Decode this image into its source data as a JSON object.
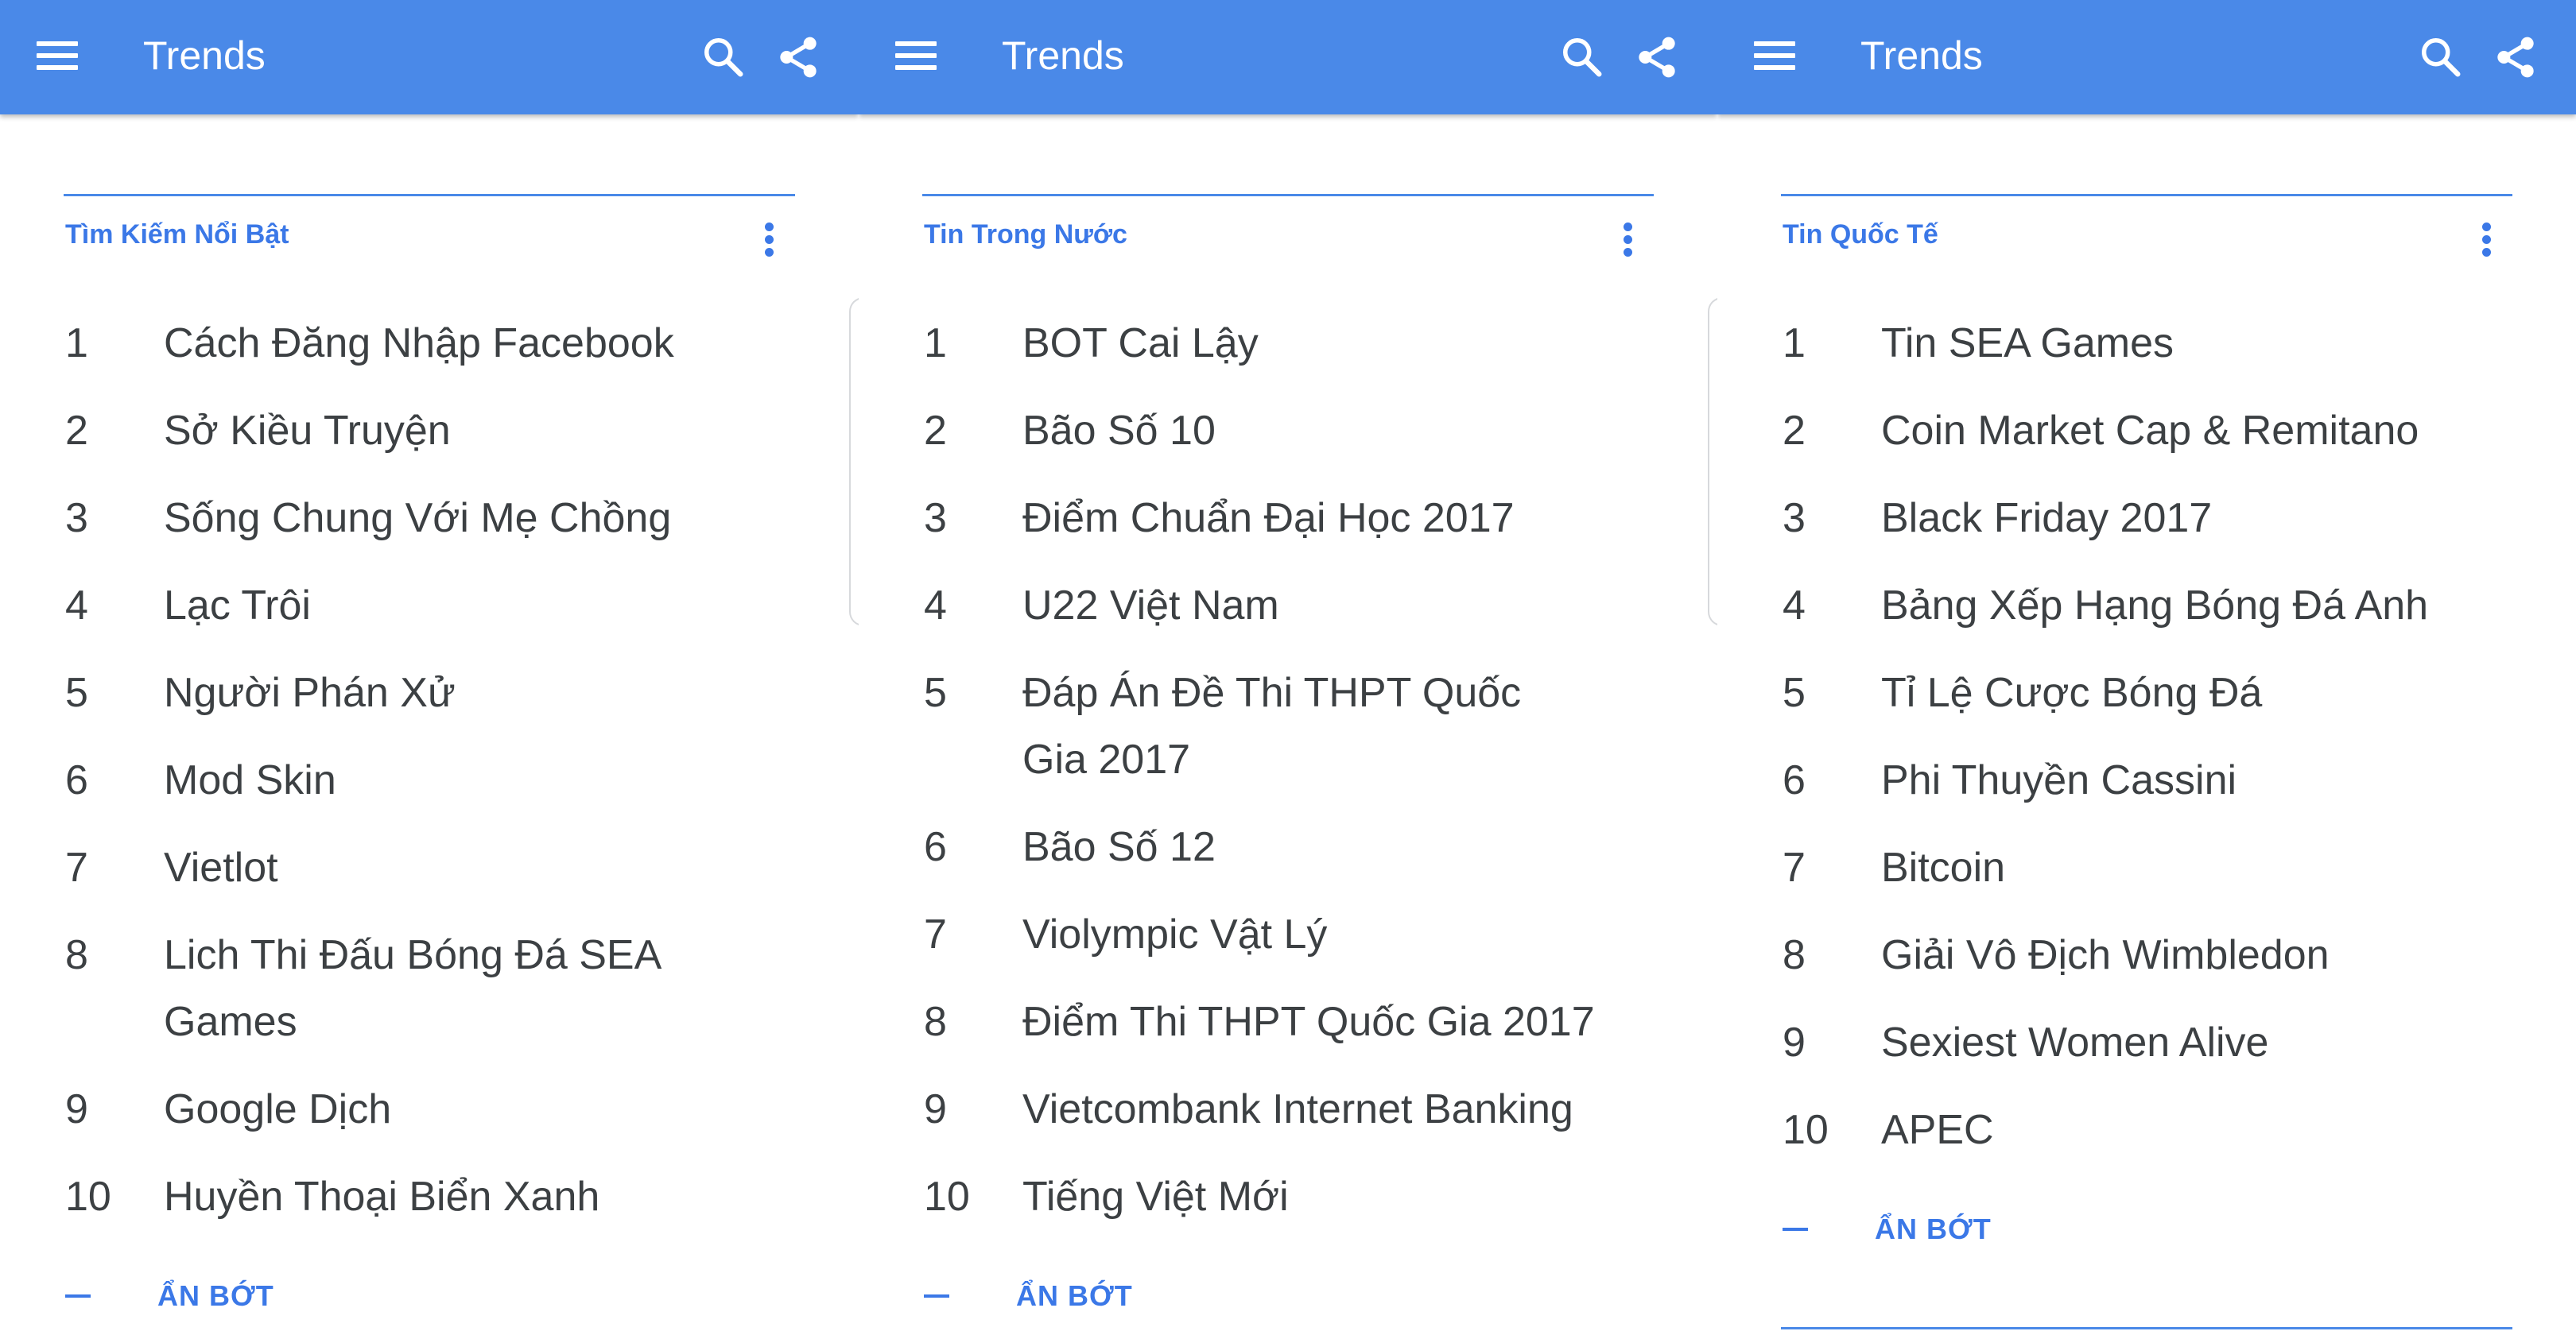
{
  "colors": {
    "appbar": "#4a89e8",
    "accent": "#3b78e7",
    "text": "#3c4043"
  },
  "icons": {
    "menu": "menu-icon",
    "search": "search-icon",
    "share": "share-icon",
    "more": "more-vert-icon"
  },
  "panels": [
    {
      "appbar_title": "Trends",
      "section_title": "Tìm Kiếm Nổi Bật",
      "items": [
        {
          "rank": "1",
          "label": "Cách Đăng Nhập Facebook"
        },
        {
          "rank": "2",
          "label": "Sở Kiều Truyện"
        },
        {
          "rank": "3",
          "label": "Sống Chung Với Mẹ Chồng"
        },
        {
          "rank": "4",
          "label": "Lạc Trôi"
        },
        {
          "rank": "5",
          "label": "Người Phán Xử"
        },
        {
          "rank": "6",
          "label": "Mod Skin"
        },
        {
          "rank": "7",
          "label": "Vietlot"
        },
        {
          "rank": "8",
          "label": "Lich Thi Đấu Bóng Đá SEA Games"
        },
        {
          "rank": "9",
          "label": "Google Dịch"
        },
        {
          "rank": "10",
          "label": "Huyền Thoại Biển Xanh"
        }
      ],
      "show_less": "ẨN BỚT"
    },
    {
      "appbar_title": "Trends",
      "section_title": "Tin Trong Nước",
      "items": [
        {
          "rank": "1",
          "label": "BOT Cai Lậy"
        },
        {
          "rank": "2",
          "label": "Bão Số 10"
        },
        {
          "rank": "3",
          "label": "Điểm Chuẩn Đại Học 2017"
        },
        {
          "rank": "4",
          "label": "U22 Việt Nam"
        },
        {
          "rank": "5",
          "label": "Đáp Án Đề Thi THPT Quốc Gia 2017"
        },
        {
          "rank": "6",
          "label": "Bão Số 12"
        },
        {
          "rank": "7",
          "label": "Violympic Vật Lý"
        },
        {
          "rank": "8",
          "label": "Điểm Thi THPT Quốc Gia 2017"
        },
        {
          "rank": "9",
          "label": "Vietcombank Internet Banking"
        },
        {
          "rank": "10",
          "label": "Tiếng Việt Mới"
        }
      ],
      "show_less": "ẨN BỚT"
    },
    {
      "appbar_title": "Trends",
      "section_title": "Tin Quốc Tế",
      "items": [
        {
          "rank": "1",
          "label": "Tin SEA Games"
        },
        {
          "rank": "2",
          "label": "Coin Market Cap & Remitano"
        },
        {
          "rank": "3",
          "label": "Black Friday 2017"
        },
        {
          "rank": "4",
          "label": "Bảng Xếp Hạng Bóng Đá Anh"
        },
        {
          "rank": "5",
          "label": "Tỉ Lệ Cược Bóng Đá"
        },
        {
          "rank": "6",
          "label": "Phi Thuyền Cassini"
        },
        {
          "rank": "7",
          "label": "Bitcoin"
        },
        {
          "rank": "8",
          "label": "Giải Vô Địch Wimbledon"
        },
        {
          "rank": "9",
          "label": "Sexiest Women Alive"
        },
        {
          "rank": "10",
          "label": "APEC"
        }
      ],
      "show_less": "ẨN BỚT"
    }
  ]
}
